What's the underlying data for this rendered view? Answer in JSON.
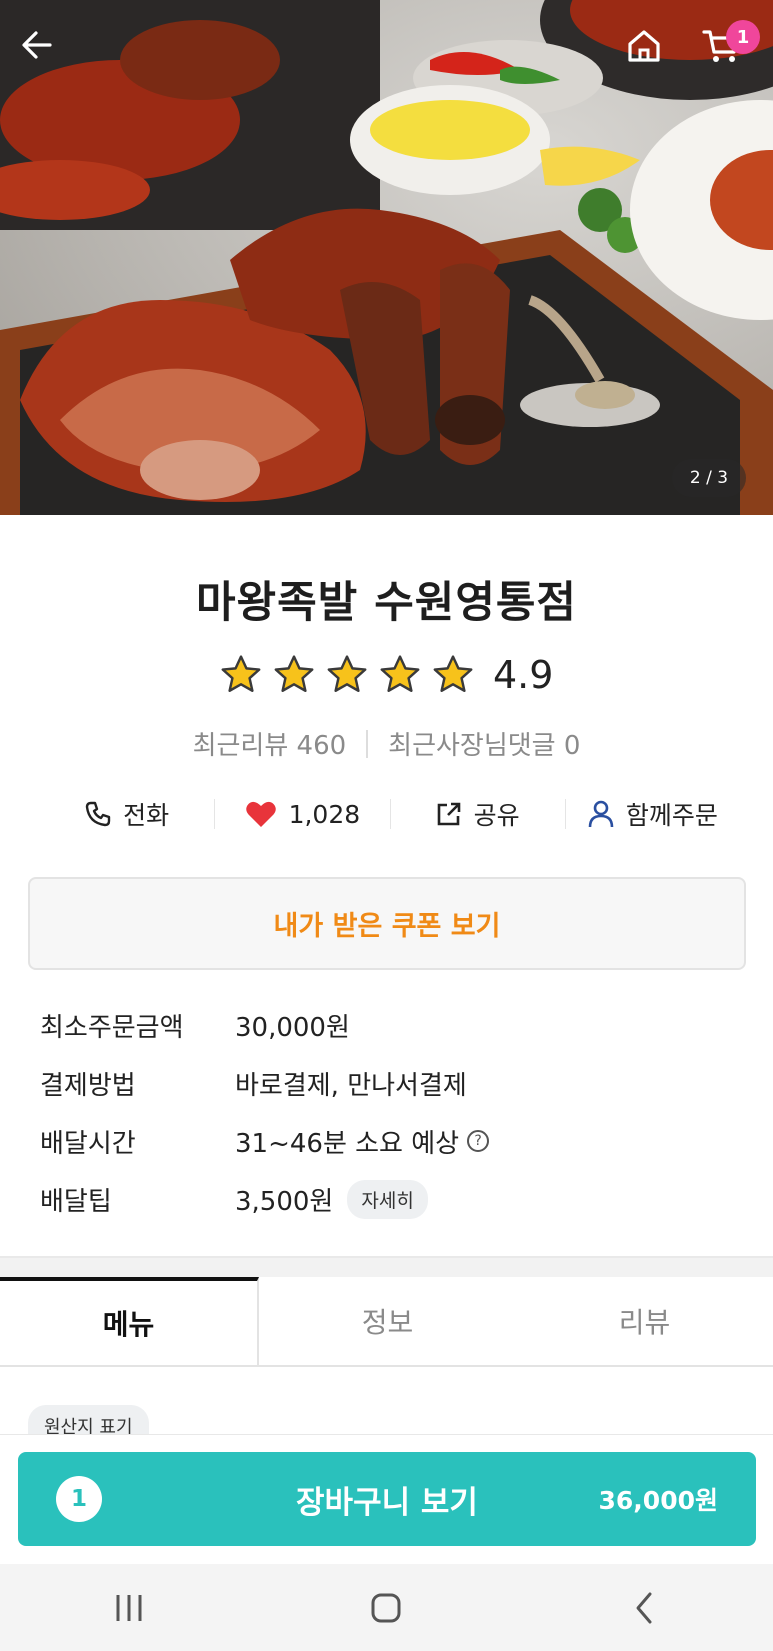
{
  "hero": {
    "image_counter": "2 / 3",
    "cart_badge": "1"
  },
  "store": {
    "name": "마왕족발 수원영통점",
    "rating_score": "4.9",
    "stars": 5,
    "recent_reviews": "최근리뷰 460",
    "recent_owner_comments": "최근사장님댓글 0"
  },
  "actions": {
    "call": "전화",
    "likes": "1,028",
    "share": "공유",
    "group_order": "함께주문"
  },
  "coupon": {
    "label": "내가 받은 쿠폰 보기"
  },
  "info": {
    "min_order_label": "최소주문금액",
    "min_order_value": "30,000원",
    "payment_label": "결제방법",
    "payment_value": "바로결제, 만나서결제",
    "delivery_time_label": "배달시간",
    "delivery_time_value": "31~46분 소요 예상",
    "delivery_tip_label": "배달팁",
    "delivery_tip_value": "3,500원",
    "detail_chip": "자세히"
  },
  "tabs": {
    "menu": "메뉴",
    "info": "정보",
    "review": "리뷰"
  },
  "origin_chip": "원산지 표기",
  "cart_button": {
    "count": "1",
    "label": "장바구니 보기",
    "total": "36,000원"
  },
  "colors": {
    "accent_mint": "#2ac1bc",
    "coupon_orange": "#f08a16",
    "badge_pink": "#f0469b",
    "heart_red": "#e8343b",
    "group_blue": "#2a4fa0"
  }
}
